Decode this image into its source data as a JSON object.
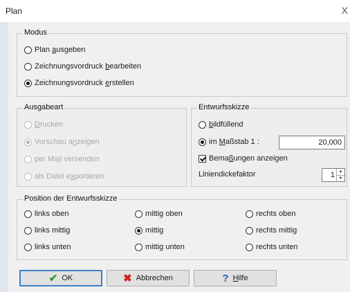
{
  "window": {
    "title": "Plan",
    "close_glyph": "X"
  },
  "modus": {
    "legend": "Modus",
    "options": [
      {
        "pre": "Plan ",
        "acc": "a",
        "post": "usgeben",
        "selected": false
      },
      {
        "pre": "Zeichnungsvordruck ",
        "acc": "b",
        "post": "earbeiten",
        "selected": false
      },
      {
        "pre": "Zeichnungsvordruck ",
        "acc": "e",
        "post": "rstellen",
        "selected": true
      }
    ]
  },
  "ausgabeart": {
    "legend": "Ausgabeart",
    "enabled": false,
    "options": [
      {
        "pre": "",
        "acc": "D",
        "post": "rucken",
        "selected": false
      },
      {
        "pre": "Vorschau a",
        "acc": "n",
        "post": "zeigen",
        "selected": true
      },
      {
        "pre": "per Ma",
        "acc": "i",
        "post": "l versenden",
        "selected": false
      },
      {
        "pre": "als Datei e",
        "acc": "x",
        "post": "portieren",
        "selected": false
      }
    ]
  },
  "entwurf": {
    "legend": "Entwurfsskizze",
    "bild": {
      "pre": "",
      "acc": "b",
      "post": "ildfüllend",
      "selected": false
    },
    "massstab": {
      "pre": "im ",
      "acc": "M",
      "post": "aßstab 1 :",
      "selected": true,
      "value": "20,000"
    },
    "bemassung": {
      "pre": "Bema",
      "acc": "ß",
      "post": "ungen anzeigen",
      "checked": true
    },
    "liniendicke": {
      "label": "Liniendickefaktor",
      "value": "1"
    }
  },
  "position": {
    "legend": "Position der Entwurfsskizze",
    "options": [
      {
        "label": "links oben",
        "selected": false
      },
      {
        "label": "mittig oben",
        "selected": false
      },
      {
        "label": "rechts oben",
        "selected": false
      },
      {
        "label": "links mittig",
        "selected": false
      },
      {
        "label": "mittig",
        "selected": true
      },
      {
        "label": "rechts mittig",
        "selected": false
      },
      {
        "label": "links unten",
        "selected": false
      },
      {
        "label": "mittig unten",
        "selected": false
      },
      {
        "label": "rechts unten",
        "selected": false
      }
    ]
  },
  "buttons": {
    "ok": {
      "label": "OK",
      "icon": "checkmark-icon"
    },
    "cancel": {
      "label": "Abbrechen",
      "icon": "cross-icon"
    },
    "help": {
      "pre": "",
      "acc": "H",
      "post": "ilfe",
      "icon": "question-icon"
    }
  }
}
